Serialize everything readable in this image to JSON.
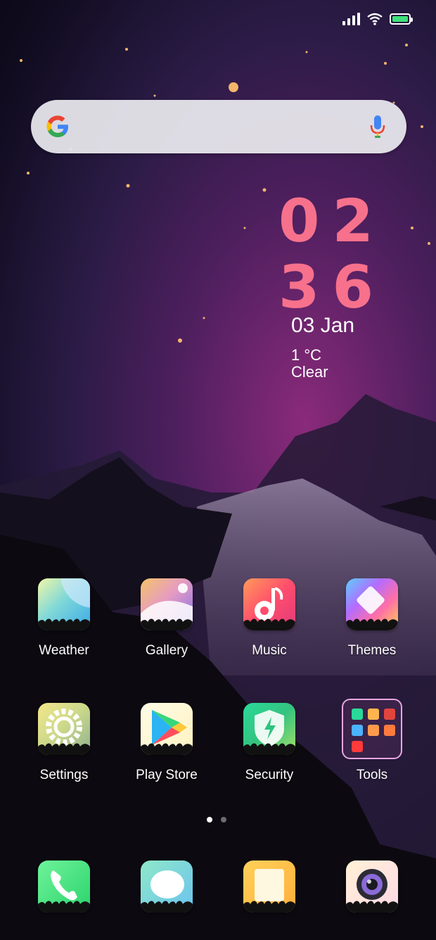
{
  "clock": {
    "hours": "02",
    "minutes": "36",
    "date": "03 Jan",
    "temperature": "1 °C",
    "condition": "Clear"
  },
  "apps": {
    "row1": [
      {
        "name": "Weather",
        "icon": "weather-icon"
      },
      {
        "name": "Gallery",
        "icon": "gallery-icon"
      },
      {
        "name": "Music",
        "icon": "music-icon"
      },
      {
        "name": "Themes",
        "icon": "themes-icon"
      }
    ],
    "row2": [
      {
        "name": "Settings",
        "icon": "settings-icon"
      },
      {
        "name": "Play Store",
        "icon": "play-store-icon"
      },
      {
        "name": "Security",
        "icon": "security-icon"
      },
      {
        "name": "Tools",
        "icon": "tools-folder-icon"
      }
    ]
  },
  "dock": [
    {
      "icon": "phone-icon"
    },
    {
      "icon": "messages-icon"
    },
    {
      "icon": "notes-icon"
    },
    {
      "icon": "camera-icon"
    }
  ],
  "pages": {
    "count": 2,
    "current": 1
  },
  "colors": {
    "clock": "#f7718c",
    "accent_green": "#3ee07a"
  }
}
